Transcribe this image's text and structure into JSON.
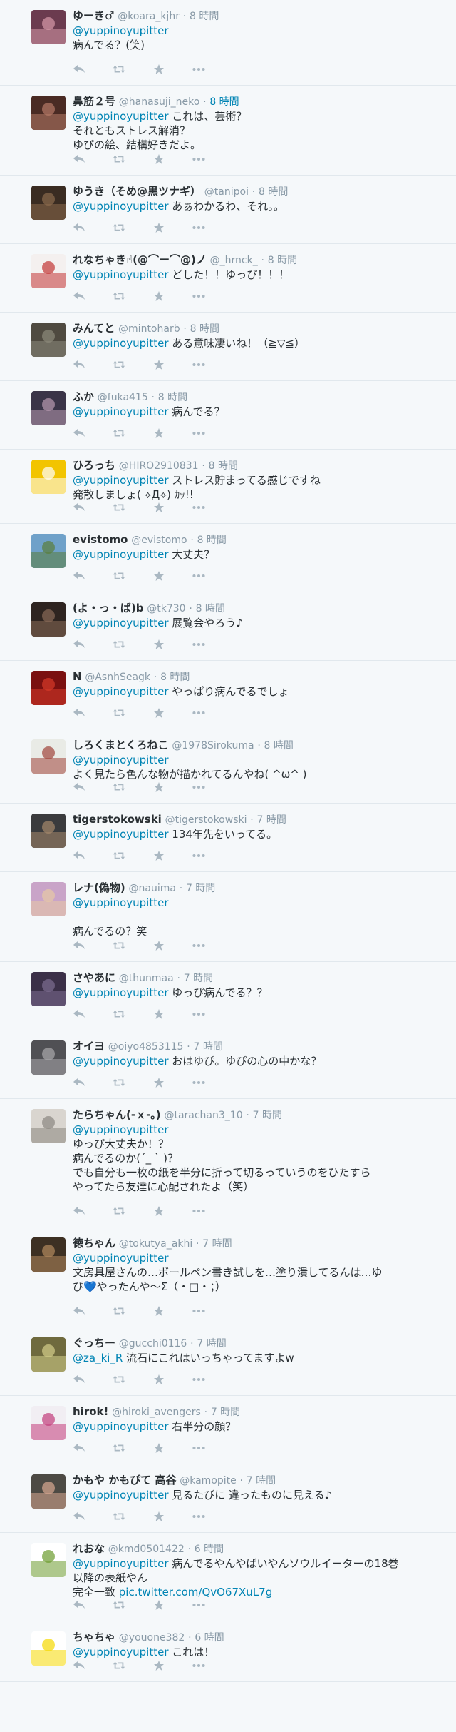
{
  "tweets": [
    {
      "name": "ゆーき♂",
      "handle": "@koara_kjhr",
      "time": "8 時間",
      "time_link": false,
      "mention": "@yuppinoyupitter",
      "text": "\n病んでる？(笑)",
      "link": "",
      "colors": [
        "#6b3b4f",
        "#d79aa9"
      ]
    },
    {
      "name": "鼻筋２号",
      "handle": "@hanasuji_neko",
      "time": "8 時間",
      "time_link": true,
      "mention": "@yuppinoyupitter",
      "text": " これは、芸術？\nそれともストレス解消？\nゆぴの絵、結構好きだよ。",
      "link": "",
      "colors": [
        "#4a2b24",
        "#b77b68"
      ]
    },
    {
      "name": "ゆうき（そめ@黒ツナギ）",
      "handle": "@tanipoi",
      "time": "8 時間",
      "time_link": false,
      "mention": "@yuppinoyupitter",
      "text": " あぁわかるわ、それ。。",
      "link": "",
      "colors": [
        "#3a2c22",
        "#8c6b4d"
      ]
    },
    {
      "name": "れなちゃき☝(@⌒ー⌒@)ノ",
      "handle": "@_hrnck_",
      "time": "8 時間",
      "time_link": false,
      "mention": "@yuppinoyupitter",
      "text": " どした！！ゆっぴ！！！",
      "link": "",
      "colors": [
        "#f4f0ef",
        "#c23535"
      ]
    },
    {
      "name": "みんてと",
      "handle": "@mintoharb",
      "time": "8 時間",
      "time_link": false,
      "mention": "@yuppinoyupitter",
      "text": " ある意味凄いね！（≧▽≦）",
      "link": "",
      "colors": [
        "#4f4a40",
        "#8d8a7b"
      ]
    },
    {
      "name": "ふか",
      "handle": "@fuka415",
      "time": "8 時間",
      "time_link": false,
      "mention": "@yuppinoyupitter",
      "text": " 病んでる？",
      "link": "",
      "colors": [
        "#3a3448",
        "#b89ab0"
      ]
    },
    {
      "name": "ひろっち",
      "handle": "@HIRO2910831",
      "time": "8 時間",
      "time_link": false,
      "mention": "@yuppinoyupitter",
      "text": " ストレス貯まってる感じですね\n発散しましょ( ⟡Д⟡) ｶｯ!!",
      "link": "",
      "colors": [
        "#f2c400",
        "#ffffff"
      ]
    },
    {
      "name": "evistomo",
      "handle": "@evistomo",
      "time": "8 時間",
      "time_link": false,
      "mention": "@yuppinoyupitter",
      "text": " 大丈夫？",
      "link": "",
      "colors": [
        "#6fa1c9",
        "#5a7d3a"
      ]
    },
    {
      "name": "(よ・っ・ば)b",
      "handle": "@tk730",
      "time": "8 時間",
      "time_link": false,
      "mention": "@yuppinoyupitter",
      "text": " 展覧会やろう♪",
      "link": "",
      "colors": [
        "#2e2420",
        "#8a6b58"
      ]
    },
    {
      "name": "N",
      "handle": "@AsnhSeagk",
      "time": "8 時間",
      "time_link": false,
      "mention": "@yuppinoyupitter",
      "text": " やっぱり病んでるでしょ",
      "link": "",
      "colors": [
        "#7a1010",
        "#d73a2a"
      ]
    },
    {
      "name": "しろくまとくろねこ",
      "handle": "@1978Sirokuma",
      "time": "8 時間",
      "time_link": false,
      "mention": "@yuppinoyupitter",
      "text": "\nよく見たら色んな物が描かれてるんやね( ^ω^ )",
      "link": "",
      "colors": [
        "#e9ebe6",
        "#a0443a"
      ]
    },
    {
      "name": "tigerstokowski",
      "handle": "@tigerstokowski",
      "time": "7 時間",
      "time_link": false,
      "mention": "@yuppinoyupitter",
      "text": " 134年先をいってる。",
      "link": "",
      "colors": [
        "#3a3b3d",
        "#a5896b"
      ]
    },
    {
      "name": "レナ(偽物)",
      "handle": "@nauima",
      "time": "7 時間",
      "time_link": false,
      "mention": "@yuppinoyupitter",
      "text": "\n\n病んでるの？笑",
      "link": "",
      "colors": [
        "#c9a4c8",
        "#e7c9a4"
      ]
    },
    {
      "name": "さやあに",
      "handle": "@thunmaa",
      "time": "7 時間",
      "time_link": false,
      "mention": "@yuppinoyupitter",
      "text": " ゆっぴ病んでる？？",
      "link": "",
      "colors": [
        "#3b3048",
        "#7d6d91"
      ]
    },
    {
      "name": "オイヨ",
      "handle": "@oiyo4853115",
      "time": "7 時間",
      "time_link": false,
      "mention": "@yuppinoyupitter",
      "text": " おはゆぴ。ゆぴの心の中かな？",
      "link": "",
      "colors": [
        "#505054",
        "#a9a8ab"
      ]
    },
    {
      "name": "たらちゃん(-ｘ-。)",
      "handle": "@tarachan3_10",
      "time": "7 時間",
      "time_link": false,
      "mention": "@yuppinoyupitter",
      "text": "\nゆっぴ大丈夫か！？\n病んでるのか(´_ ` )？\nでも自分も一枚の紙を半分に折って切るっていうのをひたすら\nやってたら友達に心配されたよ（笑）",
      "link": "",
      "colors": [
        "#d9d5cf",
        "#8a8680"
      ]
    },
    {
      "name": "徳ちゃん",
      "handle": "@tokutya_akhi",
      "time": "7 時間",
      "time_link": false,
      "mention": "@yuppinoyupitter",
      "text": "\n文房具屋さんの…ボールペン書き試しを…塗り潰してるんは…ゆ\nぴ💙やったんや〜Σ（・□・；）",
      "link": "",
      "colors": [
        "#3d3023",
        "#b48a5e"
      ]
    },
    {
      "name": "ぐっちー",
      "handle": "@gucchi0116",
      "time": "7 時間",
      "time_link": false,
      "mention": "@za_ki_R",
      "text": " 流石にこれはいっちゃってますよw",
      "link": "",
      "colors": [
        "#6f6a3e",
        "#d4cf8a"
      ]
    },
    {
      "name": "hirok!",
      "handle": "@hiroki_avengers",
      "time": "7 時間",
      "time_link": false,
      "mention": "@yuppinoyupitter",
      "text": " 右半分の顔？",
      "link": "",
      "colors": [
        "#f1eef3",
        "#c23c7a"
      ]
    },
    {
      "name": "かもや かもぴて 高谷",
      "handle": "@kamopite",
      "time": "7 時間",
      "time_link": false,
      "mention": "@yuppinoyupitter",
      "text": " 見るたびに 違ったものに見える♪",
      "link": "",
      "colors": [
        "#4d4a44",
        "#d8a892"
      ]
    },
    {
      "name": "れおな",
      "handle": "@kmd0501422",
      "time": "6 時間",
      "time_link": false,
      "mention": "@yuppinoyupitter",
      "text": " 病んでるやんやばいやんソウルイーターの18巻\n以降の表紙やん\n完全一致 ",
      "link": "pic.twitter.com/QvO67XuL7g",
      "colors": [
        "#ffffff",
        "#6b9b2d"
      ]
    },
    {
      "name": "ちゃちゃ",
      "handle": "@youone382",
      "time": "6 時間",
      "time_link": false,
      "mention": "@yuppinoyupitter",
      "text": " これは！",
      "link": "",
      "colors": [
        "#ffffff",
        "#f5d800"
      ]
    }
  ]
}
